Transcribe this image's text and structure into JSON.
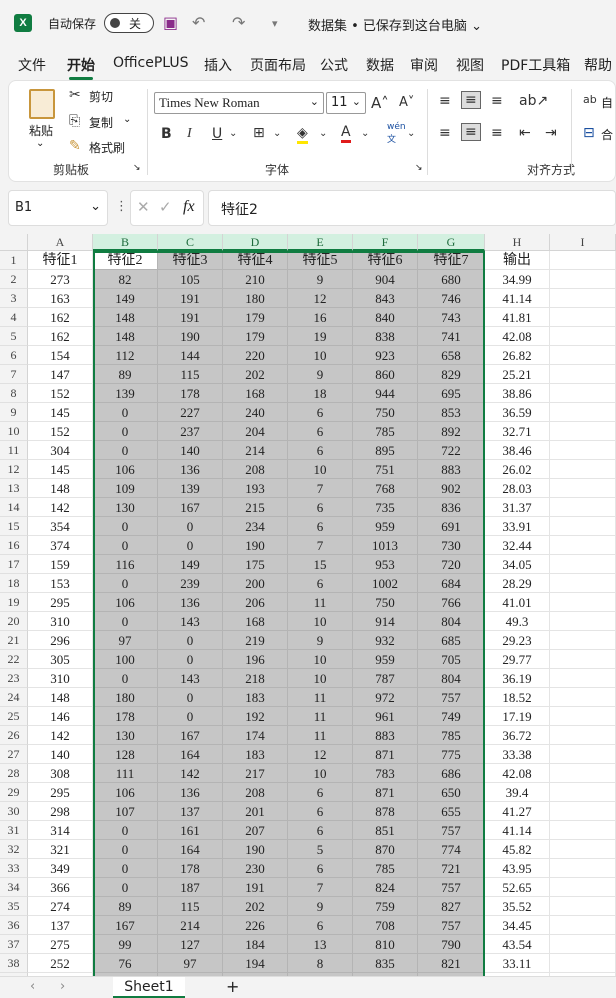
{
  "titlebar": {
    "autosave_label": "自动保存",
    "toggle_state": "关",
    "doc_title": "数据集 • 已保存到这台电脑 ⌄"
  },
  "menu": [
    "文件",
    "开始",
    "OfficePLUS",
    "插入",
    "页面布局",
    "公式",
    "数据",
    "审阅",
    "视图",
    "PDF工具箱",
    "帮助"
  ],
  "active_tab": "开始",
  "ribbon": {
    "paste": "粘贴",
    "cut": "剪切",
    "copy": "复制",
    "format_painter": "格式刷",
    "clipboard_group": "剪贴板",
    "font_name": "Times New Roman",
    "font_size": "11",
    "font_group": "字体",
    "align_group": "对齐方式",
    "wrap_text": "自",
    "merge": "合"
  },
  "formula_bar": {
    "name_box": "B1",
    "fx": "fx",
    "content": "特征2"
  },
  "columns": [
    "A",
    "B",
    "C",
    "D",
    "E",
    "F",
    "G",
    "H",
    "I"
  ],
  "selected_columns": [
    "B",
    "C",
    "D",
    "E",
    "F",
    "G"
  ],
  "headers": [
    "特征1",
    "特征2",
    "特征3",
    "特征4",
    "特征5",
    "特征6",
    "特征7",
    "输出"
  ],
  "rows": [
    [
      "273",
      "82",
      "105",
      "210",
      "9",
      "904",
      "680",
      "34.99"
    ],
    [
      "163",
      "149",
      "191",
      "180",
      "12",
      "843",
      "746",
      "41.14"
    ],
    [
      "162",
      "148",
      "191",
      "179",
      "16",
      "840",
      "743",
      "41.81"
    ],
    [
      "162",
      "148",
      "190",
      "179",
      "19",
      "838",
      "741",
      "42.08"
    ],
    [
      "154",
      "112",
      "144",
      "220",
      "10",
      "923",
      "658",
      "26.82"
    ],
    [
      "147",
      "89",
      "115",
      "202",
      "9",
      "860",
      "829",
      "25.21"
    ],
    [
      "152",
      "139",
      "178",
      "168",
      "18",
      "944",
      "695",
      "38.86"
    ],
    [
      "145",
      "0",
      "227",
      "240",
      "6",
      "750",
      "853",
      "36.59"
    ],
    [
      "152",
      "0",
      "237",
      "204",
      "6",
      "785",
      "892",
      "32.71"
    ],
    [
      "304",
      "0",
      "140",
      "214",
      "6",
      "895",
      "722",
      "38.46"
    ],
    [
      "145",
      "106",
      "136",
      "208",
      "10",
      "751",
      "883",
      "26.02"
    ],
    [
      "148",
      "109",
      "139",
      "193",
      "7",
      "768",
      "902",
      "28.03"
    ],
    [
      "142",
      "130",
      "167",
      "215",
      "6",
      "735",
      "836",
      "31.37"
    ],
    [
      "354",
      "0",
      "0",
      "234",
      "6",
      "959",
      "691",
      "33.91"
    ],
    [
      "374",
      "0",
      "0",
      "190",
      "7",
      "1013",
      "730",
      "32.44"
    ],
    [
      "159",
      "116",
      "149",
      "175",
      "15",
      "953",
      "720",
      "34.05"
    ],
    [
      "153",
      "0",
      "239",
      "200",
      "6",
      "1002",
      "684",
      "28.29"
    ],
    [
      "295",
      "106",
      "136",
      "206",
      "11",
      "750",
      "766",
      "41.01"
    ],
    [
      "310",
      "0",
      "143",
      "168",
      "10",
      "914",
      "804",
      "49.3"
    ],
    [
      "296",
      "97",
      "0",
      "219",
      "9",
      "932",
      "685",
      "29.23"
    ],
    [
      "305",
      "100",
      "0",
      "196",
      "10",
      "959",
      "705",
      "29.77"
    ],
    [
      "310",
      "0",
      "143",
      "218",
      "10",
      "787",
      "804",
      "36.19"
    ],
    [
      "148",
      "180",
      "0",
      "183",
      "11",
      "972",
      "757",
      "18.52"
    ],
    [
      "146",
      "178",
      "0",
      "192",
      "11",
      "961",
      "749",
      "17.19"
    ],
    [
      "142",
      "130",
      "167",
      "174",
      "11",
      "883",
      "785",
      "36.72"
    ],
    [
      "140",
      "128",
      "164",
      "183",
      "12",
      "871",
      "775",
      "33.38"
    ],
    [
      "308",
      "111",
      "142",
      "217",
      "10",
      "783",
      "686",
      "42.08"
    ],
    [
      "295",
      "106",
      "136",
      "208",
      "6",
      "871",
      "650",
      "39.4"
    ],
    [
      "298",
      "107",
      "137",
      "201",
      "6",
      "878",
      "655",
      "41.27"
    ],
    [
      "314",
      "0",
      "161",
      "207",
      "6",
      "851",
      "757",
      "41.14"
    ],
    [
      "321",
      "0",
      "164",
      "190",
      "5",
      "870",
      "774",
      "45.82"
    ],
    [
      "349",
      "0",
      "178",
      "230",
      "6",
      "785",
      "721",
      "43.95"
    ],
    [
      "366",
      "0",
      "187",
      "191",
      "7",
      "824",
      "757",
      "52.65"
    ],
    [
      "274",
      "89",
      "115",
      "202",
      "9",
      "759",
      "827",
      "35.52"
    ],
    [
      "137",
      "167",
      "214",
      "226",
      "6",
      "708",
      "757",
      "34.45"
    ],
    [
      "275",
      "99",
      "127",
      "184",
      "13",
      "810",
      "790",
      "43.54"
    ],
    [
      "252",
      "76",
      "97",
      "194",
      "8",
      "835",
      "821",
      "33.11"
    ]
  ],
  "sheet": {
    "tab": "Sheet1",
    "add": "+"
  }
}
